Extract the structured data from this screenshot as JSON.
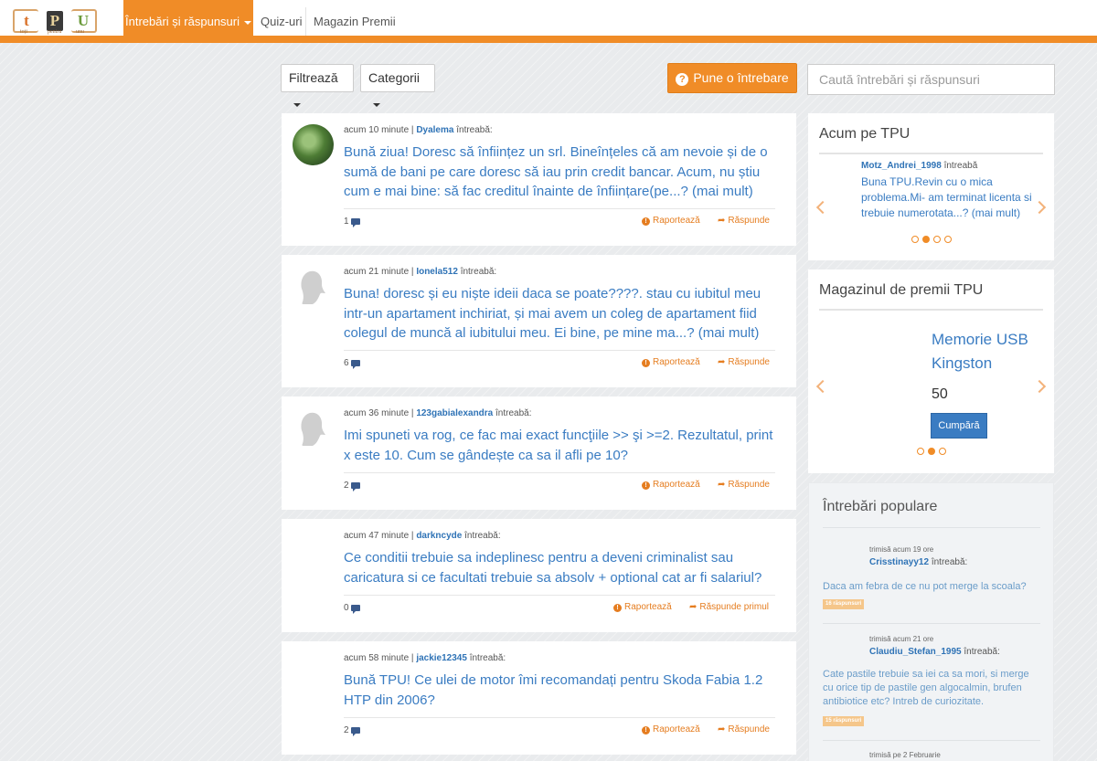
{
  "brand": {
    "letters": [
      "t",
      "P",
      "U"
    ],
    "subletters": [
      "toți",
      "pentru",
      "unu"
    ]
  },
  "nav": {
    "active": "Întrebări și răspunsuri",
    "quiz": "Quiz-uri",
    "shop": "Magazin Premii"
  },
  "toolbar": {
    "filter": "Filtrează",
    "categories": "Categorii",
    "ask": "Pune o întrebare",
    "search_placeholder": "Caută întrebări și răspunsuri"
  },
  "actions": {
    "report": "Raportează",
    "reply": "Răspunde",
    "reply_first": "Răspunde primul",
    "asks": "întreabă:"
  },
  "questions": [
    {
      "time": "acum 10 minute",
      "user": "Dyalema",
      "text": "Bună ziua! Doresc să înființez un srl. Bineînțeles că am nevoie și de o sumă de bani pe care doresc să iau prin credit bancar. Acum, nu știu cum e mai bine: să fac creditul înainte de înființare(pe...? (mai mult)",
      "count": "1",
      "reply_label": "Răspunde"
    },
    {
      "time": "acum 21 minute",
      "user": "Ionela512",
      "text": "Buna! doresc și eu niște ideii daca se poate????. stau cu iubitul meu intr-un apartament inchiriat, și mai avem un coleg de apartament fiid colegul de muncă al iubitului meu. Ei bine, pe mine ma...? (mai mult)",
      "count": "6",
      "reply_label": "Răspunde"
    },
    {
      "time": "acum 36 minute",
      "user": "123gabialexandra",
      "text": "Imi spuneti va rog, ce fac mai exact funcţiile >> şi >=2. Rezultatul, print x este 10. Cum se gândește ca sa il afli pe 10?",
      "count": "2",
      "reply_label": "Răspunde"
    },
    {
      "time": "acum 47 minute",
      "user": "darkncyde",
      "text": "Ce conditii trebuie sa indeplinesc pentru a deveni criminalist sau caricatura si ce facultati trebuie sa absolv + optional cat ar fi salariul?",
      "count": "0",
      "reply_label": "Răspunde primul"
    },
    {
      "time": "acum 58 minute",
      "user": "jackie12345",
      "text": "Bună TPU! Ce ulei de motor îmi recomandați pentru Skoda Fabia 1.2 HTP din 2006?",
      "count": "2",
      "reply_label": "Răspunde"
    }
  ],
  "now": {
    "title": "Acum pe TPU",
    "user": "Motz_Andrei_1998",
    "text": "Buna TPU.Revin cu o mica problema.Mi- am terminat licenta si trebuie numerotata...? (mai mult)"
  },
  "shop": {
    "title": "Magazinul de premii TPU",
    "product": "Memorie USB Kingston",
    "price": "50",
    "buy": "Cumpără"
  },
  "popular": {
    "title": "Întrebări populare",
    "items": [
      {
        "meta": "trimisă acum 19 ore",
        "user": "Crisstinayy12",
        "text": "Daca am febra de ce nu pot merge la scoala?",
        "answers": "16 răspunsuri"
      },
      {
        "meta": "trimisă acum 21 ore",
        "user": "Claudiu_Stefan_1995",
        "text": "Cate pastile trebuie sa iei ca sa mori, si merge cu orice tip de pastile gen algocalmin, brufen antibiotice etc? Intreb de curiozitate.",
        "answers": "15 răspunsuri"
      },
      {
        "meta": "trimisă pe 2 Februarie"
      }
    ]
  },
  "colors": {
    "accent": "#f08c27",
    "link": "#3a7cc2",
    "background": "#e9ebed"
  }
}
